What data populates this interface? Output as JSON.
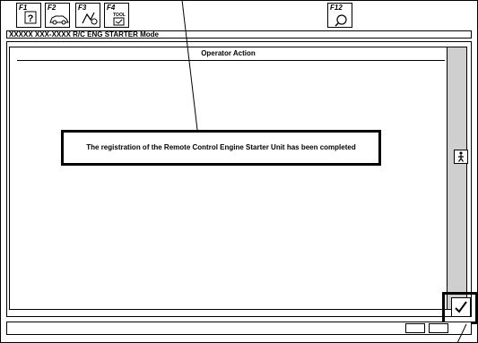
{
  "toolbar": {
    "keys": [
      {
        "label": "F1",
        "icon": "help-icon"
      },
      {
        "label": "F2",
        "icon": "car-icon"
      },
      {
        "label": "F3",
        "icon": "diagnose-icon"
      },
      {
        "label": "F4",
        "icon": "tool-icon",
        "sub": "TOOL"
      },
      {
        "label": "F12",
        "icon": "search-icon"
      }
    ]
  },
  "mode_bar": {
    "text": "XXXXX XXX-XXXX  R/C ENG STARTER Mode"
  },
  "panel": {
    "title": "Operator Action",
    "message": "The registration of the Remote Control Engine Starter Unit has been completed"
  },
  "side_button": {
    "icon": "person-icon"
  },
  "ok_button": {
    "icon": "checkmark-icon"
  }
}
